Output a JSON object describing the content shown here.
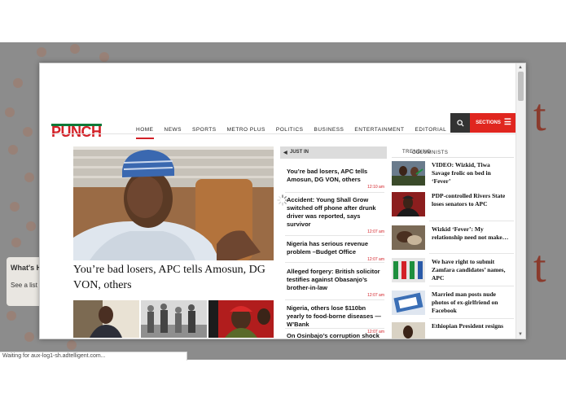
{
  "status_bar": {
    "text": "Waiting for aux-log1-sh.adtelligent.com..."
  },
  "background": {
    "glyph": "t",
    "card_title": "What's H",
    "card_text": "See a list o"
  },
  "site": {
    "logo": "PUNCH",
    "brand_color": "#d32027",
    "nav": [
      "HOME",
      "NEWS",
      "SPORTS",
      "METRO PLUS",
      "POLITICS",
      "BUSINESS",
      "ENTERTAINMENT",
      "EDITORIAL",
      "OPINION"
    ],
    "active_nav": "HOME",
    "search_icon": "search-icon",
    "sections_label": "SECTIONS",
    "sections_icon": "hamburger-icon"
  },
  "lead": {
    "headline": "You’re bad losers, APC tells Amosun, DG VON, others"
  },
  "just_in": {
    "label": "JUST IN",
    "items": [
      {
        "title": "You’re bad losers, APC tells Amosun, DG VON, others",
        "time": "12:10 am"
      },
      {
        "title": "Accident: Young Shall Grow switched off phone after drunk driver was reported, says survivor",
        "time": "12:07 am"
      },
      {
        "title": "Nigeria has serious revenue problem –Budget Office",
        "time": "12:07 am"
      },
      {
        "title": "Alleged forgery: British solicitor testifies against Obasanjo’s brother-in-law",
        "time": "12:07 am"
      },
      {
        "title": "Nigeria, others lose $110bn yearly to food-borne diseases —W’Bank",
        "time": "12:07 am"
      },
      {
        "title": "On Osinbajo’s corruption shock",
        "time": ""
      }
    ]
  },
  "sidebar": {
    "tab_trending": "TRENDING",
    "tab_columnists": "COLUMNISTS",
    "items": [
      {
        "title": "VIDEO: Wizkid, Tiwa Savage frolic on bed in ‘Fever’"
      },
      {
        "title": "PDP-controlled Rivers State loses senators to APC"
      },
      {
        "title": "Wizkid ‘Fever’: My relationship need not make…"
      },
      {
        "title": "We have right to submit Zamfara candidates’ names, APC"
      },
      {
        "title": "Married man posts nude photos of ex-girlfriend on Facebook"
      },
      {
        "title": "Ethiopian President resigns"
      }
    ]
  }
}
